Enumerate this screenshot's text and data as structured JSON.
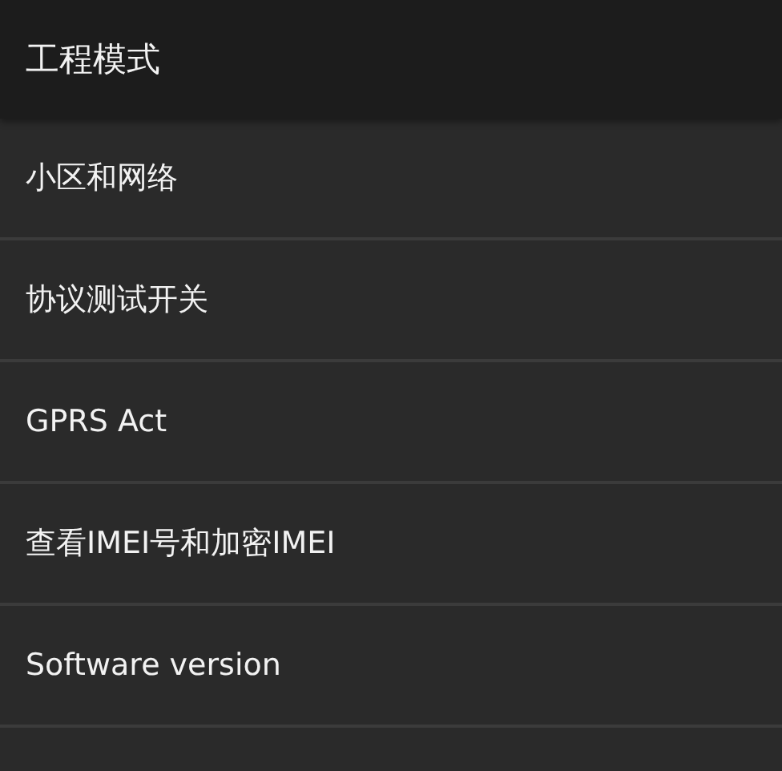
{
  "window": {
    "title": "工程模式"
  },
  "items": [
    {
      "label": "小区和网络"
    },
    {
      "label": "协议测试开关"
    },
    {
      "label": "GPRS Act"
    },
    {
      "label": "查看IMEI号和加密IMEI"
    },
    {
      "label": "Software version"
    }
  ]
}
